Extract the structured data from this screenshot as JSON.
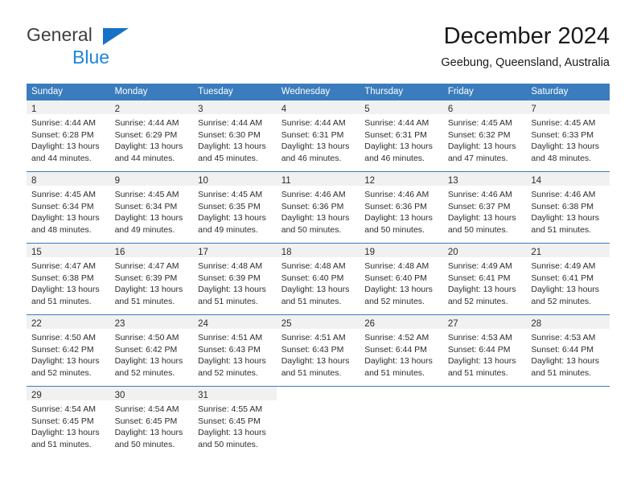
{
  "brand": {
    "line1": "General",
    "line2": "Blue",
    "triangle_color": "#1771c6",
    "line1_color": "#3f3f3f",
    "line2_color": "#1c86e0"
  },
  "header": {
    "title": "December 2024",
    "subtitle": "Geebung, Queensland, Australia"
  },
  "theme": {
    "header_bg": "#3a7cbe",
    "header_text": "#ffffff",
    "daynum_bg": "#f1f1f1",
    "text": "#2d2d2d",
    "row_divider": "#3a7cbe"
  },
  "weekdays": [
    "Sunday",
    "Monday",
    "Tuesday",
    "Wednesday",
    "Thursday",
    "Friday",
    "Saturday"
  ],
  "labels": {
    "sunrise": "Sunrise:",
    "sunset": "Sunset:",
    "daylight": "Daylight:"
  },
  "weeks": [
    [
      {
        "day": "1",
        "sunrise": "Sunrise: 4:44 AM",
        "sunset": "Sunset: 6:28 PM",
        "daylight1": "Daylight: 13 hours",
        "daylight2": "and 44 minutes."
      },
      {
        "day": "2",
        "sunrise": "Sunrise: 4:44 AM",
        "sunset": "Sunset: 6:29 PM",
        "daylight1": "Daylight: 13 hours",
        "daylight2": "and 44 minutes."
      },
      {
        "day": "3",
        "sunrise": "Sunrise: 4:44 AM",
        "sunset": "Sunset: 6:30 PM",
        "daylight1": "Daylight: 13 hours",
        "daylight2": "and 45 minutes."
      },
      {
        "day": "4",
        "sunrise": "Sunrise: 4:44 AM",
        "sunset": "Sunset: 6:31 PM",
        "daylight1": "Daylight: 13 hours",
        "daylight2": "and 46 minutes."
      },
      {
        "day": "5",
        "sunrise": "Sunrise: 4:44 AM",
        "sunset": "Sunset: 6:31 PM",
        "daylight1": "Daylight: 13 hours",
        "daylight2": "and 46 minutes."
      },
      {
        "day": "6",
        "sunrise": "Sunrise: 4:45 AM",
        "sunset": "Sunset: 6:32 PM",
        "daylight1": "Daylight: 13 hours",
        "daylight2": "and 47 minutes."
      },
      {
        "day": "7",
        "sunrise": "Sunrise: 4:45 AM",
        "sunset": "Sunset: 6:33 PM",
        "daylight1": "Daylight: 13 hours",
        "daylight2": "and 48 minutes."
      }
    ],
    [
      {
        "day": "8",
        "sunrise": "Sunrise: 4:45 AM",
        "sunset": "Sunset: 6:34 PM",
        "daylight1": "Daylight: 13 hours",
        "daylight2": "and 48 minutes."
      },
      {
        "day": "9",
        "sunrise": "Sunrise: 4:45 AM",
        "sunset": "Sunset: 6:34 PM",
        "daylight1": "Daylight: 13 hours",
        "daylight2": "and 49 minutes."
      },
      {
        "day": "10",
        "sunrise": "Sunrise: 4:45 AM",
        "sunset": "Sunset: 6:35 PM",
        "daylight1": "Daylight: 13 hours",
        "daylight2": "and 49 minutes."
      },
      {
        "day": "11",
        "sunrise": "Sunrise: 4:46 AM",
        "sunset": "Sunset: 6:36 PM",
        "daylight1": "Daylight: 13 hours",
        "daylight2": "and 50 minutes."
      },
      {
        "day": "12",
        "sunrise": "Sunrise: 4:46 AM",
        "sunset": "Sunset: 6:36 PM",
        "daylight1": "Daylight: 13 hours",
        "daylight2": "and 50 minutes."
      },
      {
        "day": "13",
        "sunrise": "Sunrise: 4:46 AM",
        "sunset": "Sunset: 6:37 PM",
        "daylight1": "Daylight: 13 hours",
        "daylight2": "and 50 minutes."
      },
      {
        "day": "14",
        "sunrise": "Sunrise: 4:46 AM",
        "sunset": "Sunset: 6:38 PM",
        "daylight1": "Daylight: 13 hours",
        "daylight2": "and 51 minutes."
      }
    ],
    [
      {
        "day": "15",
        "sunrise": "Sunrise: 4:47 AM",
        "sunset": "Sunset: 6:38 PM",
        "daylight1": "Daylight: 13 hours",
        "daylight2": "and 51 minutes."
      },
      {
        "day": "16",
        "sunrise": "Sunrise: 4:47 AM",
        "sunset": "Sunset: 6:39 PM",
        "daylight1": "Daylight: 13 hours",
        "daylight2": "and 51 minutes."
      },
      {
        "day": "17",
        "sunrise": "Sunrise: 4:48 AM",
        "sunset": "Sunset: 6:39 PM",
        "daylight1": "Daylight: 13 hours",
        "daylight2": "and 51 minutes."
      },
      {
        "day": "18",
        "sunrise": "Sunrise: 4:48 AM",
        "sunset": "Sunset: 6:40 PM",
        "daylight1": "Daylight: 13 hours",
        "daylight2": "and 51 minutes."
      },
      {
        "day": "19",
        "sunrise": "Sunrise: 4:48 AM",
        "sunset": "Sunset: 6:40 PM",
        "daylight1": "Daylight: 13 hours",
        "daylight2": "and 52 minutes."
      },
      {
        "day": "20",
        "sunrise": "Sunrise: 4:49 AM",
        "sunset": "Sunset: 6:41 PM",
        "daylight1": "Daylight: 13 hours",
        "daylight2": "and 52 minutes."
      },
      {
        "day": "21",
        "sunrise": "Sunrise: 4:49 AM",
        "sunset": "Sunset: 6:41 PM",
        "daylight1": "Daylight: 13 hours",
        "daylight2": "and 52 minutes."
      }
    ],
    [
      {
        "day": "22",
        "sunrise": "Sunrise: 4:50 AM",
        "sunset": "Sunset: 6:42 PM",
        "daylight1": "Daylight: 13 hours",
        "daylight2": "and 52 minutes."
      },
      {
        "day": "23",
        "sunrise": "Sunrise: 4:50 AM",
        "sunset": "Sunset: 6:42 PM",
        "daylight1": "Daylight: 13 hours",
        "daylight2": "and 52 minutes."
      },
      {
        "day": "24",
        "sunrise": "Sunrise: 4:51 AM",
        "sunset": "Sunset: 6:43 PM",
        "daylight1": "Daylight: 13 hours",
        "daylight2": "and 52 minutes."
      },
      {
        "day": "25",
        "sunrise": "Sunrise: 4:51 AM",
        "sunset": "Sunset: 6:43 PM",
        "daylight1": "Daylight: 13 hours",
        "daylight2": "and 51 minutes."
      },
      {
        "day": "26",
        "sunrise": "Sunrise: 4:52 AM",
        "sunset": "Sunset: 6:44 PM",
        "daylight1": "Daylight: 13 hours",
        "daylight2": "and 51 minutes."
      },
      {
        "day": "27",
        "sunrise": "Sunrise: 4:53 AM",
        "sunset": "Sunset: 6:44 PM",
        "daylight1": "Daylight: 13 hours",
        "daylight2": "and 51 minutes."
      },
      {
        "day": "28",
        "sunrise": "Sunrise: 4:53 AM",
        "sunset": "Sunset: 6:44 PM",
        "daylight1": "Daylight: 13 hours",
        "daylight2": "and 51 minutes."
      }
    ],
    [
      {
        "day": "29",
        "sunrise": "Sunrise: 4:54 AM",
        "sunset": "Sunset: 6:45 PM",
        "daylight1": "Daylight: 13 hours",
        "daylight2": "and 51 minutes."
      },
      {
        "day": "30",
        "sunrise": "Sunrise: 4:54 AM",
        "sunset": "Sunset: 6:45 PM",
        "daylight1": "Daylight: 13 hours",
        "daylight2": "and 50 minutes."
      },
      {
        "day": "31",
        "sunrise": "Sunrise: 4:55 AM",
        "sunset": "Sunset: 6:45 PM",
        "daylight1": "Daylight: 13 hours",
        "daylight2": "and 50 minutes."
      },
      {
        "day": "",
        "sunrise": "",
        "sunset": "",
        "daylight1": "",
        "daylight2": ""
      },
      {
        "day": "",
        "sunrise": "",
        "sunset": "",
        "daylight1": "",
        "daylight2": ""
      },
      {
        "day": "",
        "sunrise": "",
        "sunset": "",
        "daylight1": "",
        "daylight2": ""
      },
      {
        "day": "",
        "sunrise": "",
        "sunset": "",
        "daylight1": "",
        "daylight2": ""
      }
    ]
  ]
}
